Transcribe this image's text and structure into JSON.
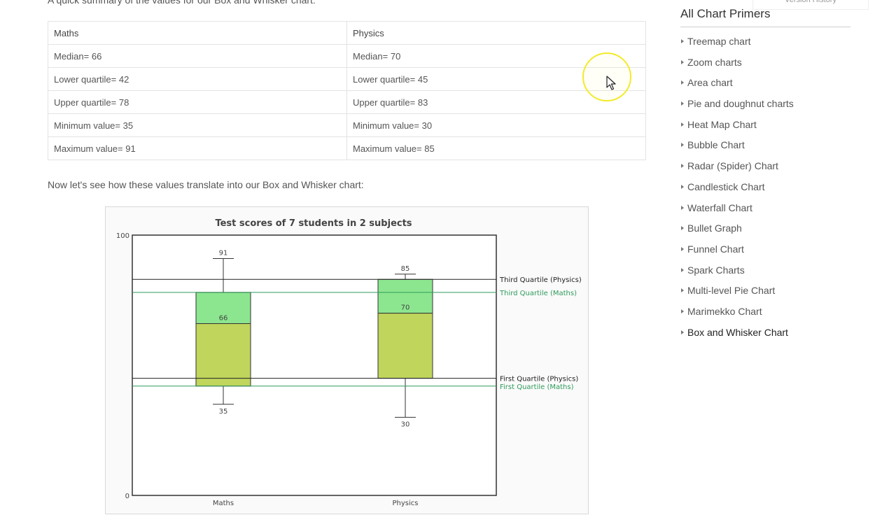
{
  "intro": "A quick summary of the values for our Box and Whisker chart:",
  "summary_table": {
    "headers": [
      "Maths",
      "Physics"
    ],
    "rows": [
      [
        "Median= 66",
        "Median= 70"
      ],
      [
        "Lower quartile= 42",
        "Lower quartile= 45"
      ],
      [
        "Upper quartile= 78",
        "Upper quartile= 83"
      ],
      [
        "Minimum value= 35",
        "Minimum value= 30"
      ],
      [
        "Maximum value= 91",
        "Maximum value= 85"
      ]
    ]
  },
  "lead": "Now let's see how these values translate into our Box and Whisker chart:",
  "version_tab": "Version History",
  "sidebar": {
    "title": "All Chart Primers",
    "items": [
      "Treemap chart",
      "Zoom charts",
      "Area chart",
      "Pie and doughnut charts",
      "Heat Map Chart",
      "Bubble Chart",
      "Radar (Spider) Chart",
      "Candlestick Chart",
      "Waterfall Chart",
      "Bullet Graph",
      "Funnel Chart",
      "Spark Charts",
      "Multi-level Pie Chart",
      "Marimekko Chart",
      "Box and Whisker Chart"
    ],
    "active_index": 14
  },
  "chart_data": {
    "type": "box",
    "title": "Test scores of 7 students in 2 subjects",
    "ylim": [
      0,
      100
    ],
    "y_ticks": [
      0,
      100
    ],
    "categories": [
      "Maths",
      "Physics"
    ],
    "boxes": [
      {
        "category": "Maths",
        "min": 35,
        "q1": 42,
        "median": 66,
        "q3": 78,
        "max": 91
      },
      {
        "category": "Physics",
        "min": 30,
        "q1": 45,
        "median": 70,
        "q3": 83,
        "max": 85
      }
    ],
    "reference_lines": [
      {
        "label": "Third Quartile (Physics)",
        "value": 83,
        "color": "#222222"
      },
      {
        "label": "Third Quartile (Maths)",
        "value": 78,
        "color": "#2e9b5c"
      },
      {
        "label": "First Quartile (Physics)",
        "value": 45,
        "color": "#222222"
      },
      {
        "label": "First Quartile (Maths)",
        "value": 42,
        "color": "#2e9b5c"
      }
    ],
    "colors": {
      "upper_box": "#8ce68f",
      "lower_box": "#bfd55c",
      "plot_bg": "#ffffff"
    }
  }
}
